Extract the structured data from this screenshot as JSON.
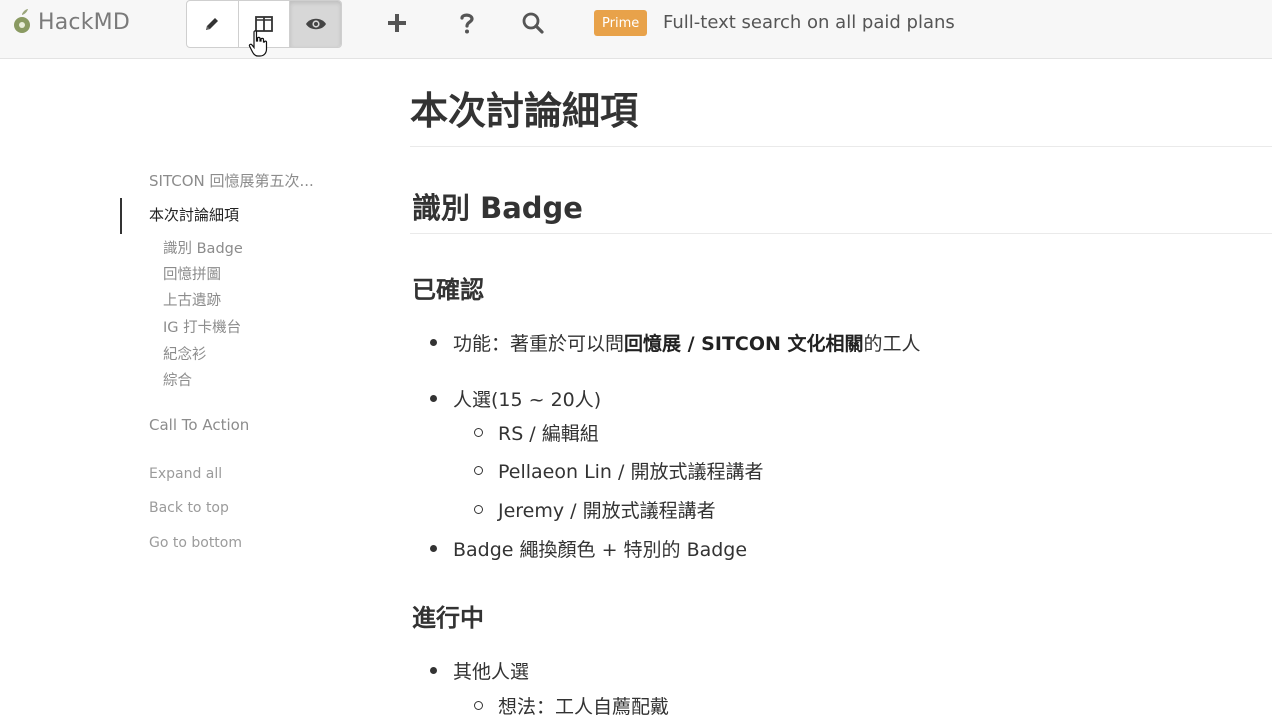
{
  "app": {
    "name": "HackMD"
  },
  "toolbar": {
    "modes": [
      {
        "label": "edit",
        "icon": "pencil-icon"
      },
      {
        "label": "both",
        "icon": "split-view-icon"
      },
      {
        "label": "view",
        "icon": "eye-icon",
        "active": true
      }
    ],
    "tools": [
      {
        "icon": "plus-icon"
      },
      {
        "icon": "help-icon"
      },
      {
        "icon": "search-icon"
      }
    ],
    "prime_badge": "Prime",
    "prime_text": "Full-text search on all paid plans",
    "accent_color": "#e8a24a"
  },
  "toc": {
    "root": "SITCON 回憶展第五次...",
    "active": "本次討論細項",
    "subitems": [
      "識別 Badge",
      "回憶拼圖",
      "上古遺跡",
      "IG 打卡機台",
      "紀念衫",
      "綜合"
    ],
    "call_to_action": "Call To Action",
    "expand_all": "Expand all",
    "back_to_top": "Back to top",
    "go_to_bottom": "Go to bottom"
  },
  "doc": {
    "h1": "本次討論細項",
    "h2": "識別 Badge",
    "section1": {
      "title": "已確認",
      "item1": {
        "prefix": "功能：著重於可以問",
        "bold": "回憶展 / SITCON 文化相關",
        "suffix": "的工人"
      },
      "item2": {
        "text": "人選(15 ~ 20人)",
        "sub": [
          "RS / 編輯組",
          "Pellaeon Lin / 開放式議程講者",
          "Jeremy / 開放式議程講者"
        ]
      },
      "item3": "Badge 繩換顏色 + 特別的 Badge"
    },
    "section2": {
      "title": "進行中",
      "item1": {
        "text": "其他人選",
        "sub": [
          "想法：工人自薦配戴"
        ]
      }
    }
  }
}
